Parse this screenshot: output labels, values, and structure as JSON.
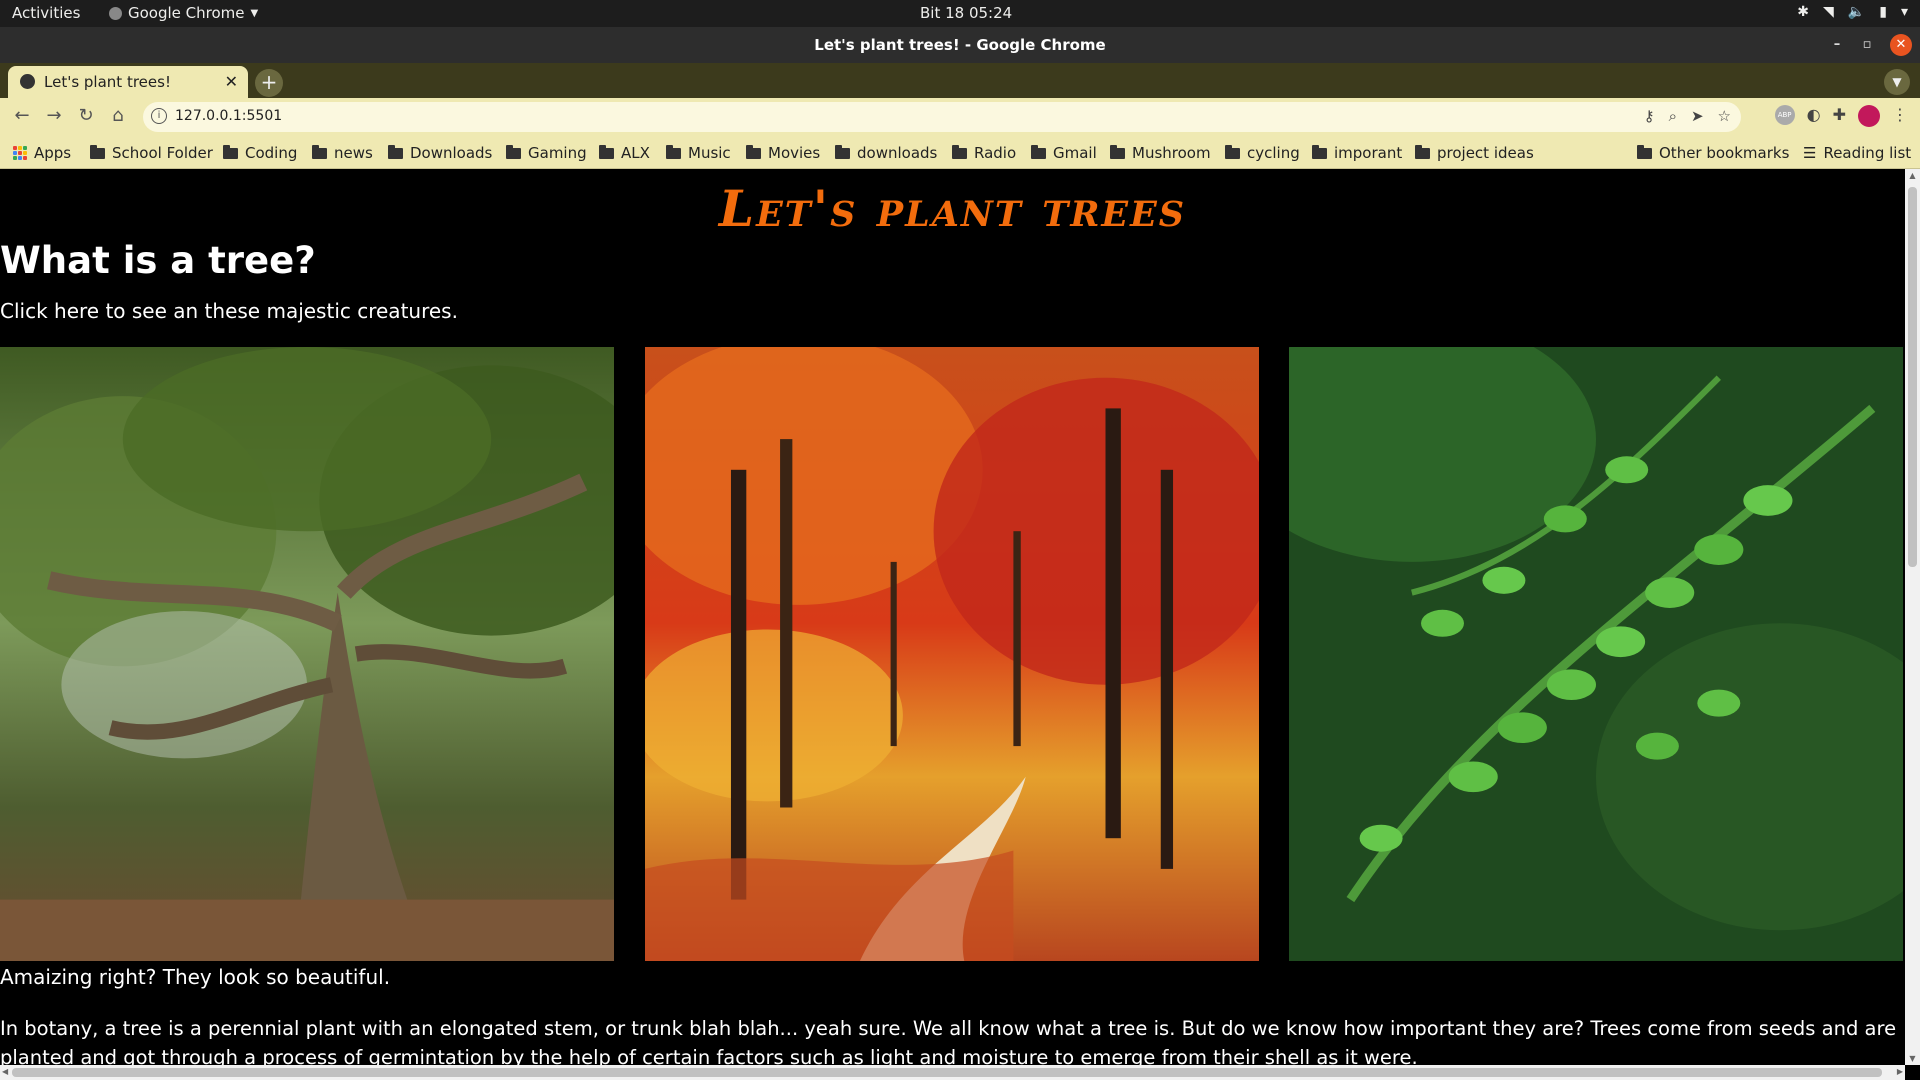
{
  "system": {
    "activities": "Activities",
    "app_name": "Google Chrome",
    "clock": "Bit 18  05:24"
  },
  "window": {
    "title": "Let's plant trees! - Google Chrome"
  },
  "tab": {
    "label": "Let's plant trees!"
  },
  "toolbar": {
    "url": "127.0.0.1:5501"
  },
  "bookmarks": {
    "apps": "Apps",
    "items": [
      "School Folder",
      "Coding",
      "news",
      "Downloads",
      "Gaming",
      "ALX",
      "Music",
      "Movies",
      "downloads",
      "Radio",
      "Gmail",
      "Mushroom",
      "cycling",
      "imporant",
      "project ideas"
    ],
    "other": "Other bookmarks",
    "reading_list": "Reading list"
  },
  "page": {
    "title": "Let's plant trees",
    "heading": "What is a tree?",
    "lead": "Click here to see an these majestic creatures.",
    "caption": "Amaizing right? They look so beautiful.",
    "paragraph": "In botany, a tree is a perennial plant with an elongated stem, or trunk blah blah... yeah sure. We all know what a tree is. But do we know how important they are? Trees come from seeds and are planted and got through a process of germintation by the help of certain factors such as light and moisture to emerge from their shell as it were.",
    "title_color": "#f26c0d"
  }
}
